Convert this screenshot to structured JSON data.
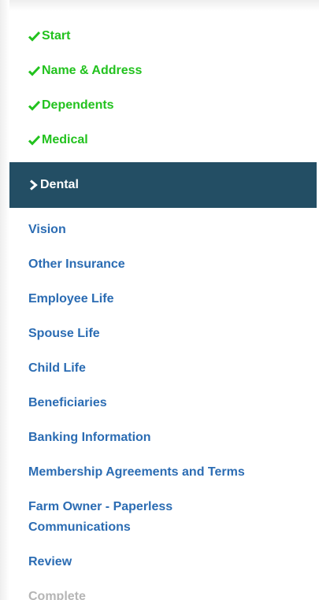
{
  "steps": {
    "completed": [
      {
        "label": "Start"
      },
      {
        "label": "Name & Address"
      },
      {
        "label": "Dependents"
      },
      {
        "label": "Medical"
      }
    ],
    "current": {
      "label": "Dental"
    },
    "upcoming": [
      {
        "label": "Vision"
      },
      {
        "label": "Other Insurance"
      },
      {
        "label": "Employee Life"
      },
      {
        "label": "Spouse Life"
      },
      {
        "label": "Child Life"
      },
      {
        "label": "Beneficiaries"
      },
      {
        "label": "Banking Information"
      },
      {
        "label": "Membership Agreements and Terms"
      },
      {
        "label": "Farm Owner - Paperless Communications"
      },
      {
        "label": "Review"
      }
    ],
    "disabled": [
      {
        "label": "Complete"
      }
    ]
  },
  "colors": {
    "completed": "#22c21e",
    "current_bg": "#234e64",
    "current_text": "#ffffff",
    "upcoming": "#2b6cb3",
    "disabled": "#b5b5b5"
  },
  "icons": {
    "completed": "checkmark-icon",
    "current": "chevron-right-icon"
  }
}
